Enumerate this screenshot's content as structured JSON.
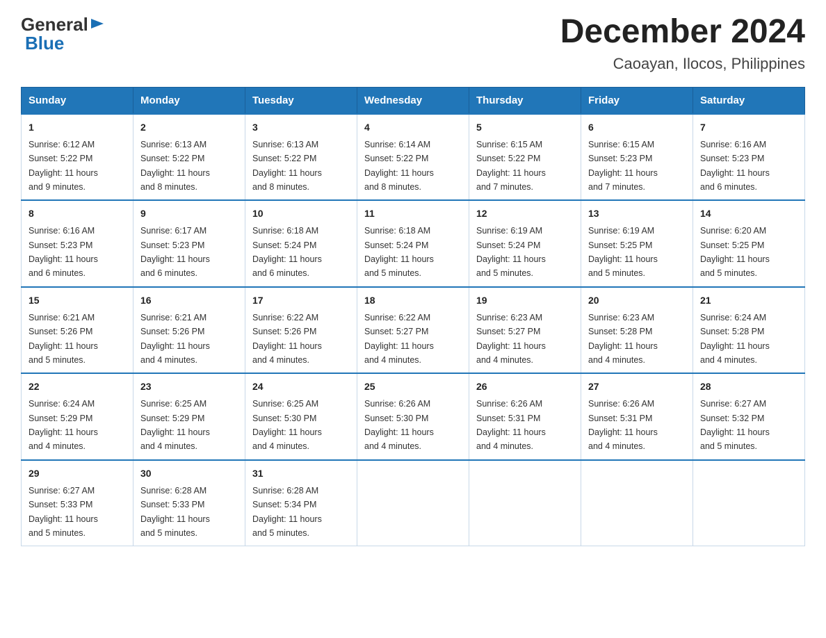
{
  "logo": {
    "general": "General",
    "blue": "Blue",
    "arrow_color": "#1a6fb5"
  },
  "title": "December 2024",
  "subtitle": "Caoayan, Ilocos, Philippines",
  "headers": [
    "Sunday",
    "Monday",
    "Tuesday",
    "Wednesday",
    "Thursday",
    "Friday",
    "Saturday"
  ],
  "weeks": [
    [
      {
        "day": "1",
        "sunrise": "6:12 AM",
        "sunset": "5:22 PM",
        "daylight": "11 hours and 9 minutes."
      },
      {
        "day": "2",
        "sunrise": "6:13 AM",
        "sunset": "5:22 PM",
        "daylight": "11 hours and 8 minutes."
      },
      {
        "day": "3",
        "sunrise": "6:13 AM",
        "sunset": "5:22 PM",
        "daylight": "11 hours and 8 minutes."
      },
      {
        "day": "4",
        "sunrise": "6:14 AM",
        "sunset": "5:22 PM",
        "daylight": "11 hours and 8 minutes."
      },
      {
        "day": "5",
        "sunrise": "6:15 AM",
        "sunset": "5:22 PM",
        "daylight": "11 hours and 7 minutes."
      },
      {
        "day": "6",
        "sunrise": "6:15 AM",
        "sunset": "5:23 PM",
        "daylight": "11 hours and 7 minutes."
      },
      {
        "day": "7",
        "sunrise": "6:16 AM",
        "sunset": "5:23 PM",
        "daylight": "11 hours and 6 minutes."
      }
    ],
    [
      {
        "day": "8",
        "sunrise": "6:16 AM",
        "sunset": "5:23 PM",
        "daylight": "11 hours and 6 minutes."
      },
      {
        "day": "9",
        "sunrise": "6:17 AM",
        "sunset": "5:23 PM",
        "daylight": "11 hours and 6 minutes."
      },
      {
        "day": "10",
        "sunrise": "6:18 AM",
        "sunset": "5:24 PM",
        "daylight": "11 hours and 6 minutes."
      },
      {
        "day": "11",
        "sunrise": "6:18 AM",
        "sunset": "5:24 PM",
        "daylight": "11 hours and 5 minutes."
      },
      {
        "day": "12",
        "sunrise": "6:19 AM",
        "sunset": "5:24 PM",
        "daylight": "11 hours and 5 minutes."
      },
      {
        "day": "13",
        "sunrise": "6:19 AM",
        "sunset": "5:25 PM",
        "daylight": "11 hours and 5 minutes."
      },
      {
        "day": "14",
        "sunrise": "6:20 AM",
        "sunset": "5:25 PM",
        "daylight": "11 hours and 5 minutes."
      }
    ],
    [
      {
        "day": "15",
        "sunrise": "6:21 AM",
        "sunset": "5:26 PM",
        "daylight": "11 hours and 5 minutes."
      },
      {
        "day": "16",
        "sunrise": "6:21 AM",
        "sunset": "5:26 PM",
        "daylight": "11 hours and 4 minutes."
      },
      {
        "day": "17",
        "sunrise": "6:22 AM",
        "sunset": "5:26 PM",
        "daylight": "11 hours and 4 minutes."
      },
      {
        "day": "18",
        "sunrise": "6:22 AM",
        "sunset": "5:27 PM",
        "daylight": "11 hours and 4 minutes."
      },
      {
        "day": "19",
        "sunrise": "6:23 AM",
        "sunset": "5:27 PM",
        "daylight": "11 hours and 4 minutes."
      },
      {
        "day": "20",
        "sunrise": "6:23 AM",
        "sunset": "5:28 PM",
        "daylight": "11 hours and 4 minutes."
      },
      {
        "day": "21",
        "sunrise": "6:24 AM",
        "sunset": "5:28 PM",
        "daylight": "11 hours and 4 minutes."
      }
    ],
    [
      {
        "day": "22",
        "sunrise": "6:24 AM",
        "sunset": "5:29 PM",
        "daylight": "11 hours and 4 minutes."
      },
      {
        "day": "23",
        "sunrise": "6:25 AM",
        "sunset": "5:29 PM",
        "daylight": "11 hours and 4 minutes."
      },
      {
        "day": "24",
        "sunrise": "6:25 AM",
        "sunset": "5:30 PM",
        "daylight": "11 hours and 4 minutes."
      },
      {
        "day": "25",
        "sunrise": "6:26 AM",
        "sunset": "5:30 PM",
        "daylight": "11 hours and 4 minutes."
      },
      {
        "day": "26",
        "sunrise": "6:26 AM",
        "sunset": "5:31 PM",
        "daylight": "11 hours and 4 minutes."
      },
      {
        "day": "27",
        "sunrise": "6:26 AM",
        "sunset": "5:31 PM",
        "daylight": "11 hours and 4 minutes."
      },
      {
        "day": "28",
        "sunrise": "6:27 AM",
        "sunset": "5:32 PM",
        "daylight": "11 hours and 5 minutes."
      }
    ],
    [
      {
        "day": "29",
        "sunrise": "6:27 AM",
        "sunset": "5:33 PM",
        "daylight": "11 hours and 5 minutes."
      },
      {
        "day": "30",
        "sunrise": "6:28 AM",
        "sunset": "5:33 PM",
        "daylight": "11 hours and 5 minutes."
      },
      {
        "day": "31",
        "sunrise": "6:28 AM",
        "sunset": "5:34 PM",
        "daylight": "11 hours and 5 minutes."
      },
      null,
      null,
      null,
      null
    ]
  ],
  "labels": {
    "sunrise": "Sunrise:",
    "sunset": "Sunset:",
    "daylight": "Daylight:"
  }
}
